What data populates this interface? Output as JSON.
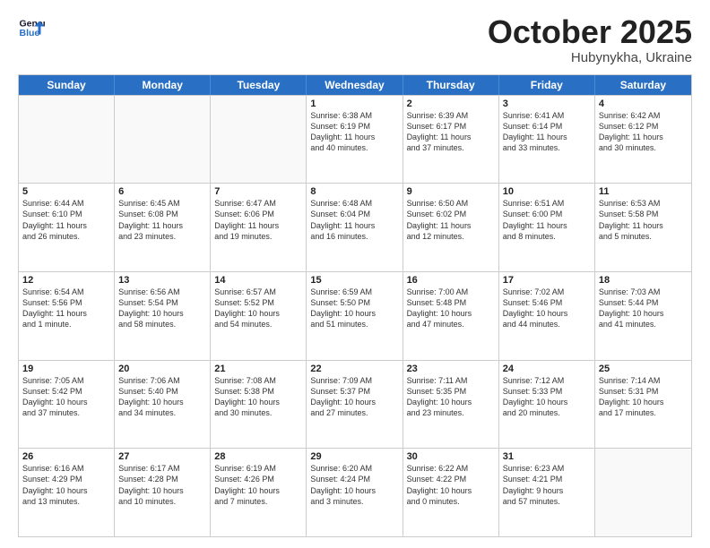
{
  "header": {
    "logo_line1": "General",
    "logo_line2": "Blue",
    "month": "October 2025",
    "location": "Hubynykha, Ukraine"
  },
  "weekdays": [
    "Sunday",
    "Monday",
    "Tuesday",
    "Wednesday",
    "Thursday",
    "Friday",
    "Saturday"
  ],
  "rows": [
    [
      {
        "day": "",
        "info": ""
      },
      {
        "day": "",
        "info": ""
      },
      {
        "day": "",
        "info": ""
      },
      {
        "day": "1",
        "info": "Sunrise: 6:38 AM\nSunset: 6:19 PM\nDaylight: 11 hours\nand 40 minutes."
      },
      {
        "day": "2",
        "info": "Sunrise: 6:39 AM\nSunset: 6:17 PM\nDaylight: 11 hours\nand 37 minutes."
      },
      {
        "day": "3",
        "info": "Sunrise: 6:41 AM\nSunset: 6:14 PM\nDaylight: 11 hours\nand 33 minutes."
      },
      {
        "day": "4",
        "info": "Sunrise: 6:42 AM\nSunset: 6:12 PM\nDaylight: 11 hours\nand 30 minutes."
      }
    ],
    [
      {
        "day": "5",
        "info": "Sunrise: 6:44 AM\nSunset: 6:10 PM\nDaylight: 11 hours\nand 26 minutes."
      },
      {
        "day": "6",
        "info": "Sunrise: 6:45 AM\nSunset: 6:08 PM\nDaylight: 11 hours\nand 23 minutes."
      },
      {
        "day": "7",
        "info": "Sunrise: 6:47 AM\nSunset: 6:06 PM\nDaylight: 11 hours\nand 19 minutes."
      },
      {
        "day": "8",
        "info": "Sunrise: 6:48 AM\nSunset: 6:04 PM\nDaylight: 11 hours\nand 16 minutes."
      },
      {
        "day": "9",
        "info": "Sunrise: 6:50 AM\nSunset: 6:02 PM\nDaylight: 11 hours\nand 12 minutes."
      },
      {
        "day": "10",
        "info": "Sunrise: 6:51 AM\nSunset: 6:00 PM\nDaylight: 11 hours\nand 8 minutes."
      },
      {
        "day": "11",
        "info": "Sunrise: 6:53 AM\nSunset: 5:58 PM\nDaylight: 11 hours\nand 5 minutes."
      }
    ],
    [
      {
        "day": "12",
        "info": "Sunrise: 6:54 AM\nSunset: 5:56 PM\nDaylight: 11 hours\nand 1 minute."
      },
      {
        "day": "13",
        "info": "Sunrise: 6:56 AM\nSunset: 5:54 PM\nDaylight: 10 hours\nand 58 minutes."
      },
      {
        "day": "14",
        "info": "Sunrise: 6:57 AM\nSunset: 5:52 PM\nDaylight: 10 hours\nand 54 minutes."
      },
      {
        "day": "15",
        "info": "Sunrise: 6:59 AM\nSunset: 5:50 PM\nDaylight: 10 hours\nand 51 minutes."
      },
      {
        "day": "16",
        "info": "Sunrise: 7:00 AM\nSunset: 5:48 PM\nDaylight: 10 hours\nand 47 minutes."
      },
      {
        "day": "17",
        "info": "Sunrise: 7:02 AM\nSunset: 5:46 PM\nDaylight: 10 hours\nand 44 minutes."
      },
      {
        "day": "18",
        "info": "Sunrise: 7:03 AM\nSunset: 5:44 PM\nDaylight: 10 hours\nand 41 minutes."
      }
    ],
    [
      {
        "day": "19",
        "info": "Sunrise: 7:05 AM\nSunset: 5:42 PM\nDaylight: 10 hours\nand 37 minutes."
      },
      {
        "day": "20",
        "info": "Sunrise: 7:06 AM\nSunset: 5:40 PM\nDaylight: 10 hours\nand 34 minutes."
      },
      {
        "day": "21",
        "info": "Sunrise: 7:08 AM\nSunset: 5:38 PM\nDaylight: 10 hours\nand 30 minutes."
      },
      {
        "day": "22",
        "info": "Sunrise: 7:09 AM\nSunset: 5:37 PM\nDaylight: 10 hours\nand 27 minutes."
      },
      {
        "day": "23",
        "info": "Sunrise: 7:11 AM\nSunset: 5:35 PM\nDaylight: 10 hours\nand 23 minutes."
      },
      {
        "day": "24",
        "info": "Sunrise: 7:12 AM\nSunset: 5:33 PM\nDaylight: 10 hours\nand 20 minutes."
      },
      {
        "day": "25",
        "info": "Sunrise: 7:14 AM\nSunset: 5:31 PM\nDaylight: 10 hours\nand 17 minutes."
      }
    ],
    [
      {
        "day": "26",
        "info": "Sunrise: 6:16 AM\nSunset: 4:29 PM\nDaylight: 10 hours\nand 13 minutes."
      },
      {
        "day": "27",
        "info": "Sunrise: 6:17 AM\nSunset: 4:28 PM\nDaylight: 10 hours\nand 10 minutes."
      },
      {
        "day": "28",
        "info": "Sunrise: 6:19 AM\nSunset: 4:26 PM\nDaylight: 10 hours\nand 7 minutes."
      },
      {
        "day": "29",
        "info": "Sunrise: 6:20 AM\nSunset: 4:24 PM\nDaylight: 10 hours\nand 3 minutes."
      },
      {
        "day": "30",
        "info": "Sunrise: 6:22 AM\nSunset: 4:22 PM\nDaylight: 10 hours\nand 0 minutes."
      },
      {
        "day": "31",
        "info": "Sunrise: 6:23 AM\nSunset: 4:21 PM\nDaylight: 9 hours\nand 57 minutes."
      },
      {
        "day": "",
        "info": ""
      }
    ]
  ]
}
